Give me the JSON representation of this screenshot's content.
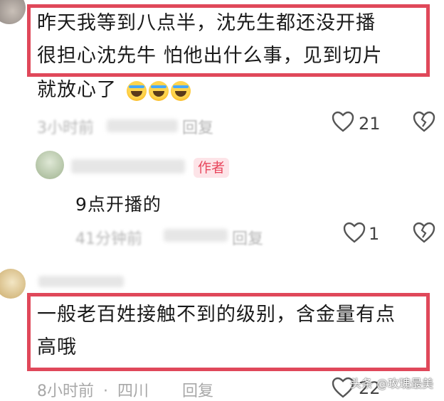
{
  "comment1": {
    "line1": "昨天我等到八点半，沈先生都还没开播",
    "line2": "很担心沈先牛 怕他出什么事，见到切片",
    "line3": "就放心了",
    "emoji_name": "crying-laughing-emoji",
    "meta_time": "3小时前",
    "reply_label": "回复",
    "like_count": "21"
  },
  "reply1": {
    "badge": "作者",
    "text": "9点开播的",
    "meta_time": "41分钟前",
    "reply_label": "回复",
    "like_count": "1"
  },
  "comment2": {
    "line1": "一般老百姓接触不到的级别，含金量有点",
    "line2": "高哦",
    "meta_time": "8小时前",
    "meta_sep": "·",
    "meta_location": "四川",
    "reply_label": "回复",
    "like_count": "22"
  },
  "watermark": "头条 @玫瑰最美",
  "colors": {
    "highlight": "#e0485a",
    "author_badge": "#e8475d",
    "meta": "#b5b5b5"
  }
}
